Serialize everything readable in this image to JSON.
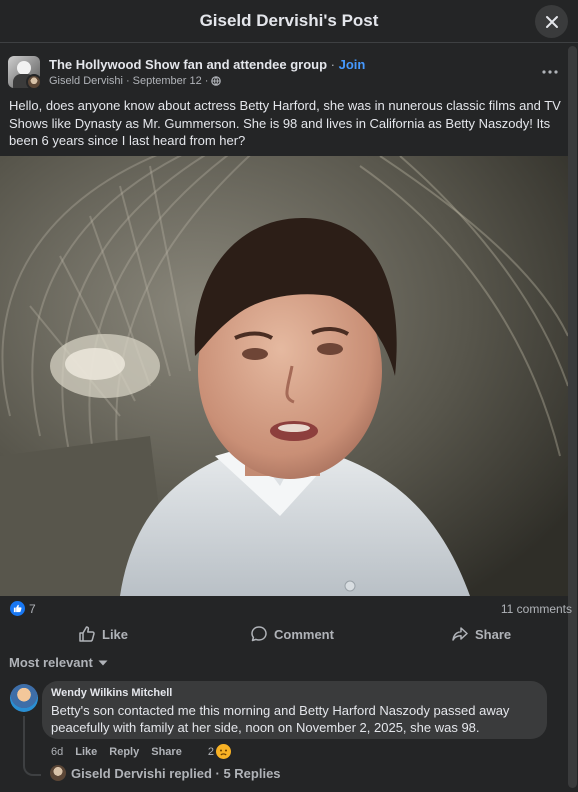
{
  "modal": {
    "title": "Giseld Dervishi's Post"
  },
  "post": {
    "group_name": "The Hollywood Show fan and attendee group",
    "separator": " · ",
    "join_label": "Join",
    "author": "Giseld Dervishi",
    "date": "September 12",
    "audience_icon": "globe-icon",
    "text": "Hello, does anyone know about actress Betty Harford, she was in nunerous classic films and TV Shows like Dynasty as Mr. Gummerson. She is 98 and lives in California as Betty Naszody! Its been 6 years since I last heard from her?",
    "reaction_count": "7",
    "comment_count": "11 comments"
  },
  "actions": {
    "like": "Like",
    "comment": "Comment",
    "share": "Share"
  },
  "sort": {
    "label": "Most relevant"
  },
  "comment": {
    "author": "Wendy Wilkins Mitchell",
    "text": "Betty's son contacted me this morning and Betty Harford Naszody passed away peacefully with family at her side, noon on November 2, 2025, she was 98.",
    "time": "6d",
    "like": "Like",
    "reply": "Reply",
    "share": "Share",
    "reaction_count": "2",
    "replied_text": "Giseld Dervishi replied · 5 Replies"
  },
  "colors": {
    "background": "#242526",
    "accent": "#4599ff",
    "like_blue": "#1877f2"
  }
}
